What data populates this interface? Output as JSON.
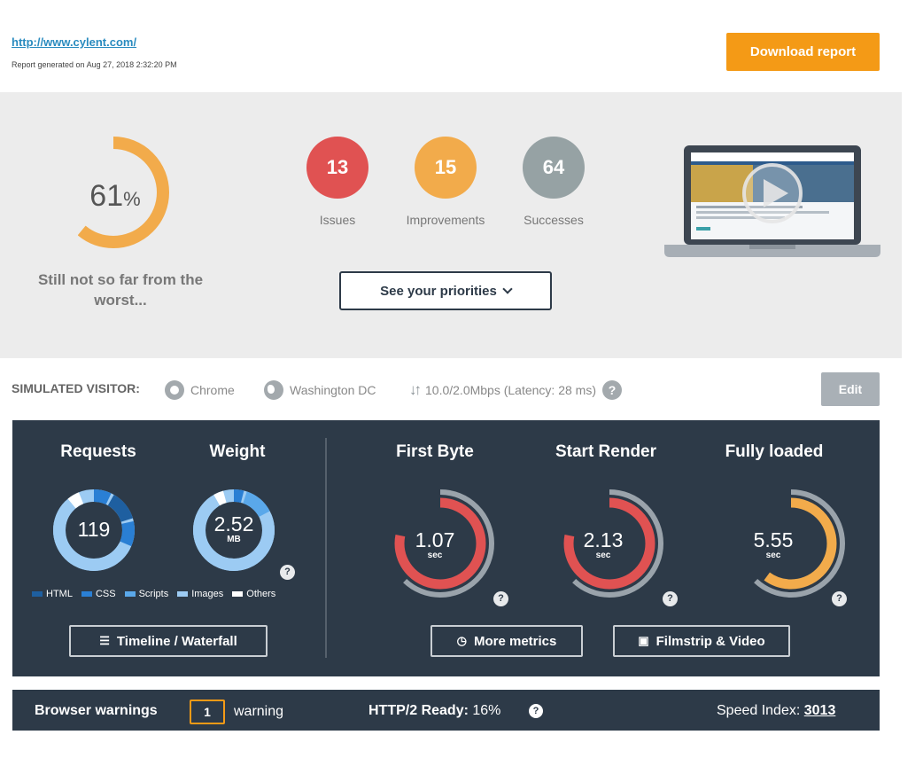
{
  "header": {
    "url": "http://www.cylent.com/",
    "generated": "Report generated on Aug 27, 2018 2:32:20 PM",
    "download_label": "Download report"
  },
  "summary": {
    "score": "61",
    "score_fraction": 0.61,
    "score_unit": "%",
    "message": "Still not so far from the worst...",
    "stats": [
      {
        "value": "13",
        "label": "Issues",
        "color": "#e05252"
      },
      {
        "value": "15",
        "label": "Improvements",
        "color": "#f2ab4b"
      },
      {
        "value": "64",
        "label": "Successes",
        "color": "#96a2a4"
      }
    ],
    "priorities_label": "See your priorities"
  },
  "visitor": {
    "title": "SIMULATED VISITOR:",
    "browser": "Chrome",
    "location": "Washington DC",
    "connection": "10.0/2.0Mbps (Latency: 28 ms)",
    "help": "?",
    "edit_label": "Edit"
  },
  "metrics": {
    "requests": {
      "title": "Requests",
      "value": "119"
    },
    "weight": {
      "title": "Weight",
      "value": "2.52",
      "unit": "MB"
    },
    "legend": [
      {
        "label": "HTML",
        "color": "#1e5fa0"
      },
      {
        "label": "CSS",
        "color": "#2a7fd4"
      },
      {
        "label": "Scripts",
        "color": "#5aa8ea"
      },
      {
        "label": "Images",
        "color": "#9ccbf3"
      },
      {
        "label": "Others",
        "color": "#ffffff"
      }
    ],
    "first_byte": {
      "title": "First Byte",
      "value": "1.07",
      "unit": "sec",
      "color": "#e05252",
      "fraction": 0.78
    },
    "start_render": {
      "title": "Start Render",
      "value": "2.13",
      "unit": "sec",
      "color": "#e05252",
      "fraction": 0.78
    },
    "fully_loaded": {
      "title": "Fully loaded",
      "value": "5.55",
      "unit": "sec",
      "color": "#f2ab4b",
      "fraction": 0.6
    },
    "timeline_label": "Timeline / Waterfall",
    "more_metrics_label": "More metrics",
    "filmstrip_label": "Filmstrip & Video",
    "help": "?"
  },
  "warnings": {
    "title": "Browser warnings",
    "count": "1",
    "word": "warning",
    "http2_label": "HTTP/2 Ready:",
    "http2_value": "16%",
    "speed_index_label": "Speed Index:",
    "speed_index_value": "3013",
    "help": "?"
  }
}
